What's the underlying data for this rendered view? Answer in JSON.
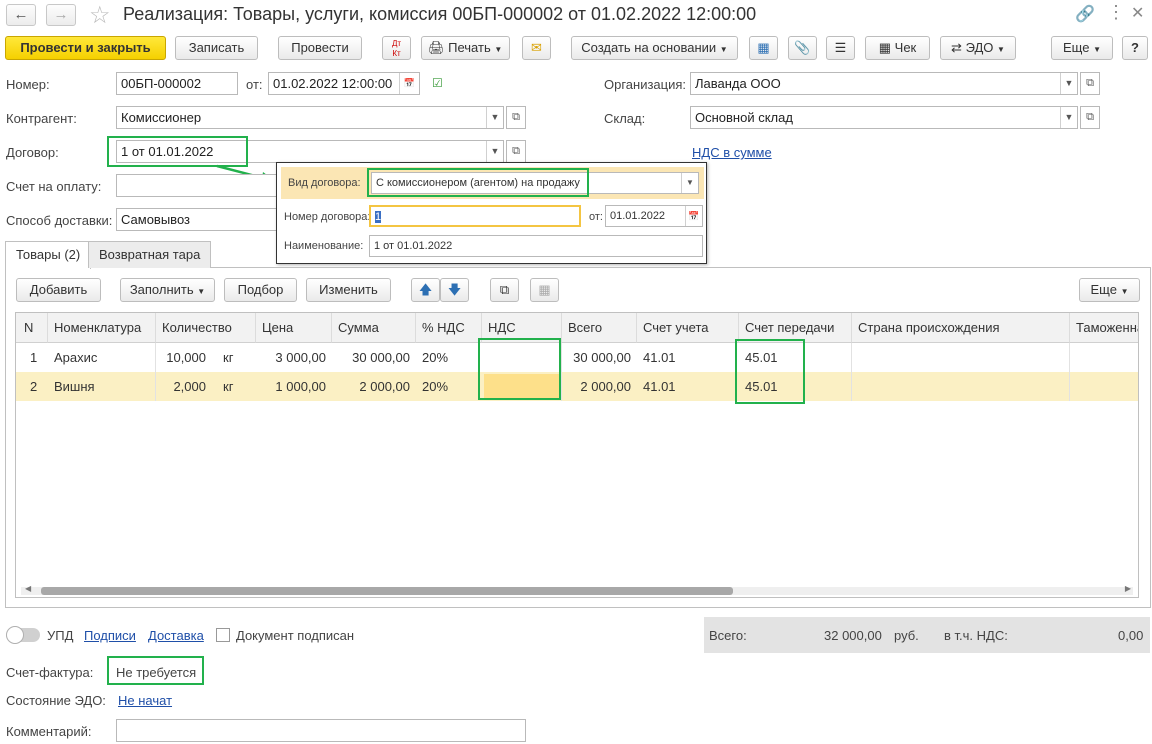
{
  "window": {
    "title": "Реализация: Товары, услуги, комиссия 00БП-000002 от 01.02.2022 12:00:00",
    "icons": [
      "back-arrow-icon",
      "forward-arrow-icon",
      "star-icon",
      "link-icon",
      "menu-dots-icon",
      "close-icon"
    ]
  },
  "toolbar": {
    "post_close": "Провести и закрыть",
    "save": "Записать",
    "post": "Провести",
    "dt_kt": "Дт Кт",
    "print": "Печать",
    "create_based": "Создать на основании",
    "check": "Чек",
    "edo": "ЭДО",
    "more": "Еще",
    "help": "?"
  },
  "header": {
    "number_label": "Номер:",
    "number": "00БП-000002",
    "date_label": "от:",
    "date": "01.02.2022 12:00:00",
    "org_label": "Организация:",
    "org": "Лаванда ООО",
    "contractor_label": "Контрагент:",
    "contractor": "Комиссионер",
    "warehouse_label": "Склад:",
    "warehouse": "Основной склад",
    "contract_label": "Договор:",
    "contract": "1 от 01.01.2022",
    "vat_link": "НДС в сумме",
    "invoice_label": "Счет на оплату:",
    "delivery_label": "Способ доставки:",
    "delivery": "Самовывоз"
  },
  "popup": {
    "kind_label": "Вид договора:",
    "kind": "С комиссионером (агентом) на продажу",
    "num_label": "Номер договора:",
    "num": "1",
    "from_label": "от:",
    "from": "01.01.2022",
    "name_label": "Наименование:",
    "name": "1 от 01.01.2022"
  },
  "tabs": [
    {
      "label": "Товары (2)"
    },
    {
      "label": "Возвратная тара"
    }
  ],
  "table_toolbar": {
    "add": "Добавить",
    "fill": "Заполнить",
    "pick": "Подбор",
    "change": "Изменить",
    "more": "Еще"
  },
  "table": {
    "columns": [
      "N",
      "Номенклатура",
      "Количество",
      "Цена",
      "Сумма",
      "% НДС",
      "НДС",
      "Всего",
      "Счет учета",
      "Счет передачи",
      "Страна происхождения",
      "Таможенна"
    ],
    "rows": [
      {
        "n": "1",
        "item": "Арахис",
        "qty": "10,000",
        "unit": "кг",
        "price": "3 000,00",
        "sum": "30 000,00",
        "vat_rate": "20%",
        "vat": "",
        "total": "30 000,00",
        "account": "41.01",
        "transfer_account": "45.01"
      },
      {
        "n": "2",
        "item": "Вишня",
        "qty": "2,000",
        "unit": "кг",
        "price": "1 000,00",
        "sum": "2 000,00",
        "vat_rate": "20%",
        "vat": "",
        "total": "2 000,00",
        "account": "41.01",
        "transfer_account": "45.01"
      }
    ]
  },
  "footer": {
    "upd": "УПД",
    "signatures": "Подписи",
    "delivery": "Доставка",
    "signed": "Документ подписан",
    "total_label": "Всего:",
    "total": "32 000,00",
    "currency": "руб.",
    "vat_incl_label": "в т.ч. НДС:",
    "vat_incl": "0,00",
    "invoice_label": "Счет-фактура:",
    "invoice_value": "Не требуется",
    "edo_label": "Состояние ЭДО:",
    "edo_value": "Не начат",
    "comment_label": "Комментарий:"
  },
  "colors": {
    "primary_button": "#f5d000",
    "highlight_green": "#22b14c",
    "selected_row": "#fbf0c4",
    "link": "#1f4fa8"
  }
}
